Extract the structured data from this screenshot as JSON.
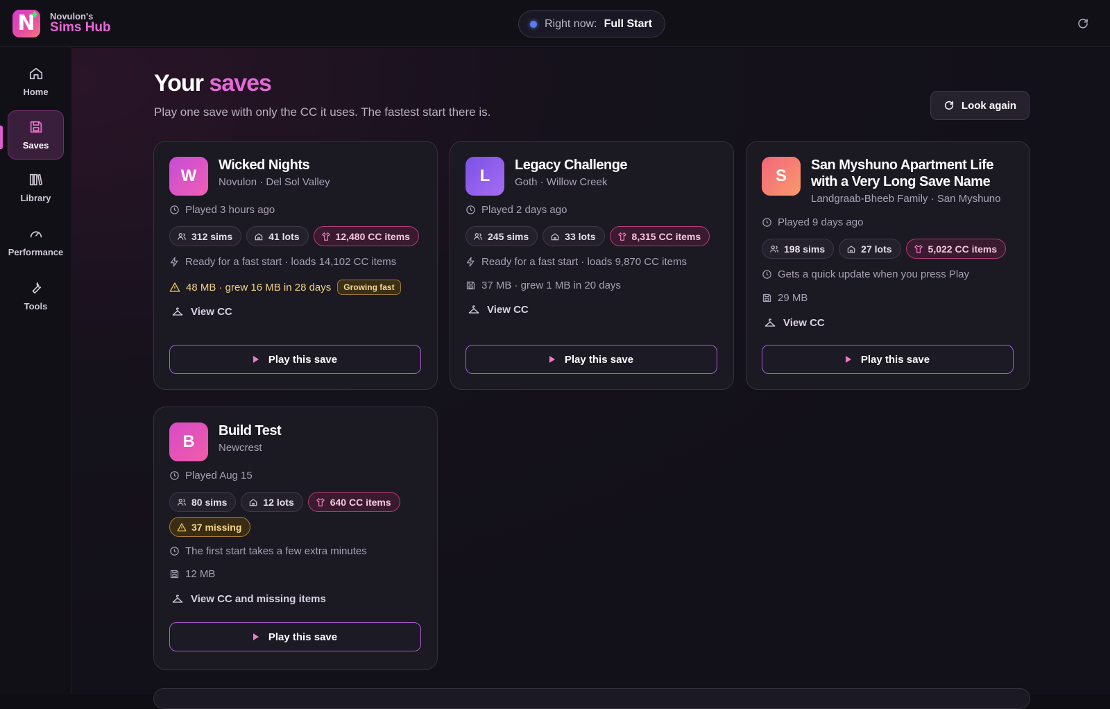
{
  "app": {
    "brand_top": "Novulon's",
    "brand_name": "Sims Hub"
  },
  "status": {
    "label": "Right now:",
    "value": "Full Start"
  },
  "sidebar": {
    "items": [
      {
        "label": "Home",
        "icon": "home-icon"
      },
      {
        "label": "Saves",
        "icon": "save-icon",
        "active": true
      },
      {
        "label": "Library",
        "icon": "library-icon"
      },
      {
        "label": "Performance",
        "icon": "gauge-icon"
      },
      {
        "label": "Tools",
        "icon": "wrench-icon"
      }
    ]
  },
  "page": {
    "title_plain": "Your",
    "title_accent": "saves",
    "subtitle": "Play one save with only the CC it uses. The fastest start there is.",
    "look_again": "Look again"
  },
  "saves": [
    {
      "initial": "W",
      "name": "Wicked Nights",
      "subtitle": "Novulon · Del Sol Valley",
      "played": "Played 3 hours ago",
      "sims": "312 sims",
      "lots": "41 lots",
      "cc": "12,480 CC items",
      "status": "Ready for a fast start · loads 14,102 CC items",
      "size": "48 MB · grew 16 MB in 28 days",
      "size_tag": "Growing fast",
      "view": "View CC",
      "play": "Play this save"
    },
    {
      "initial": "L",
      "name": "Legacy Challenge",
      "subtitle": "Goth · Willow Creek",
      "played": "Played 2 days ago",
      "sims": "245 sims",
      "lots": "33 lots",
      "cc": "8,315 CC items",
      "status": "Ready for a fast start · loads 9,870 CC items",
      "size": "37 MB · grew 1 MB in 20 days",
      "view": "View CC",
      "play": "Play this save"
    },
    {
      "initial": "S",
      "name": "San Myshuno Apartment Life with a Very Long Save Name",
      "subtitle": "Landgraab-Bheeb Family · San Myshuno",
      "played": "Played 9 days ago",
      "sims": "198 sims",
      "lots": "27 lots",
      "cc": "5,022 CC items",
      "status": "Gets a quick update when you press Play",
      "size": "29 MB",
      "view": "View CC",
      "play": "Play this save"
    },
    {
      "initial": "B",
      "name": "Build Test",
      "subtitle": "Newcrest",
      "played": "Played Aug 15",
      "sims": "80 sims",
      "lots": "12 lots",
      "cc": "640 CC items",
      "missing": "37 missing",
      "status": "The first start takes a few extra minutes",
      "size": "12 MB",
      "view": "View CC and missing items",
      "play": "Play this save"
    }
  ],
  "colors": {
    "accent": "#e46ad7",
    "avatar_w": "#d84fcf",
    "avatar_l": "#8b5cf6",
    "avatar_s": "#f2707a",
    "avatar_b": "#e054c0",
    "warning": "#f3d283"
  }
}
